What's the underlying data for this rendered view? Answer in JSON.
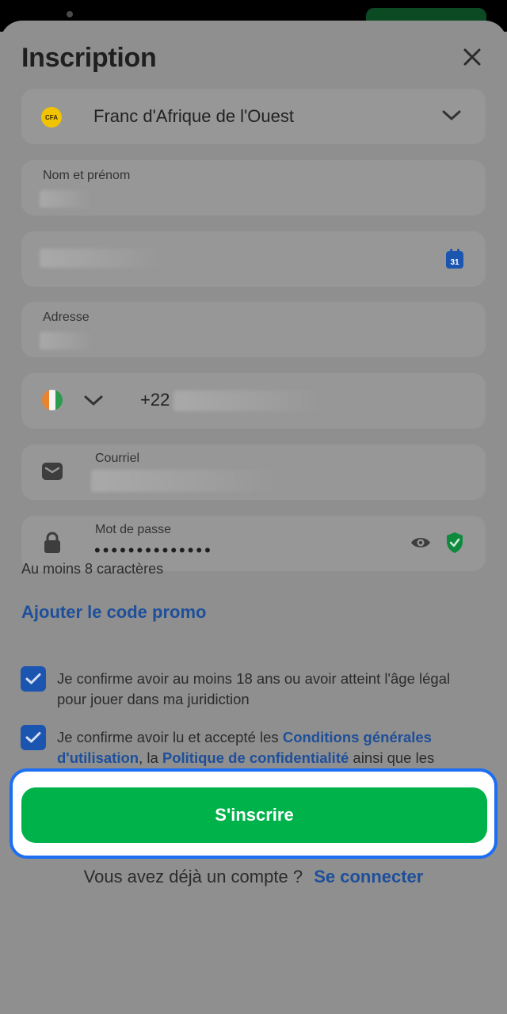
{
  "header": {
    "title": "Inscription"
  },
  "form": {
    "currency": {
      "badge": "CFA",
      "label": "Franc d'Afrique de l'Ouest"
    },
    "full_name": {
      "label": "Nom et prénom"
    },
    "address": {
      "label": "Adresse"
    },
    "phone": {
      "prefix": "+22"
    },
    "email": {
      "label": "Courriel"
    },
    "password": {
      "label": "Mot de passe",
      "value": "••••••••••••••"
    },
    "password_hint": "Au moins 8 caractères",
    "promo_link": "Ajouter le code promo",
    "consent_age": "Je confirme avoir au moins 18 ans ou avoir atteint l'âge légal pour jouer dans ma juridiction",
    "consent_terms": {
      "prefix": "Je confirme avoir lu et accepté les",
      "terms_link": "Conditions générales d'utilisation",
      "mid": ", la",
      "privacy_link": "Politique de confidentialité",
      "suffix": "ainsi que les autres conditions applicables"
    },
    "submit_label": "S'inscrire"
  },
  "footer": {
    "question": "Vous avez déjà un compte ?",
    "login_link": "Se connecter"
  },
  "colors": {
    "accent_green": "#00b24a",
    "link_blue": "#1e4f9a",
    "highlight_blue": "#1c6ef2"
  }
}
